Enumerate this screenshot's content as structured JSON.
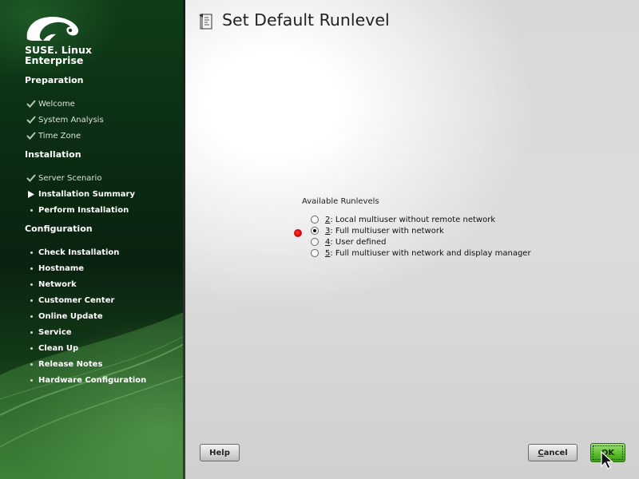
{
  "sidebar": {
    "brand_line1": "SUSE. Linux",
    "brand_line2": "Enterprise",
    "sections": [
      {
        "title": "Preparation",
        "items": [
          {
            "label": "Welcome",
            "state": "done"
          },
          {
            "label": "System Analysis",
            "state": "done"
          },
          {
            "label": "Time Zone",
            "state": "done"
          }
        ]
      },
      {
        "title": "Installation",
        "items": [
          {
            "label": "Server Scenario",
            "state": "done"
          },
          {
            "label": "Installation Summary",
            "state": "current"
          },
          {
            "label": "Perform Installation",
            "state": "todo"
          }
        ]
      },
      {
        "title": "Configuration",
        "items": [
          {
            "label": "Check Installation",
            "state": "todo"
          },
          {
            "label": "Hostname",
            "state": "todo"
          },
          {
            "label": "Network",
            "state": "todo"
          },
          {
            "label": "Customer Center",
            "state": "todo"
          },
          {
            "label": "Online Update",
            "state": "todo"
          },
          {
            "label": "Service",
            "state": "todo"
          },
          {
            "label": "Clean Up",
            "state": "todo"
          },
          {
            "label": "Release Notes",
            "state": "todo"
          },
          {
            "label": "Hardware Configuration",
            "state": "todo"
          }
        ]
      }
    ]
  },
  "main": {
    "title": "Set Default Runlevel",
    "group_label": "Available Runlevels",
    "runlevels": [
      {
        "key": "2",
        "text": ": Local multiuser without remote network",
        "checked": false
      },
      {
        "key": "3",
        "text": ": Full multiuser with network",
        "checked": true
      },
      {
        "key": "4",
        "text": ": User defined",
        "checked": false
      },
      {
        "key": "5",
        "text": ": Full multiuser with network and display manager",
        "checked": false
      }
    ]
  },
  "buttons": {
    "help": "Help",
    "cancel_key": "C",
    "cancel_rest": "ancel",
    "ok_key": "O",
    "ok_rest": "K"
  },
  "colors": {
    "sidebar_green": "#0b2a12",
    "ok_green": "#5cbf2b",
    "selection_marker": "#e00000"
  }
}
